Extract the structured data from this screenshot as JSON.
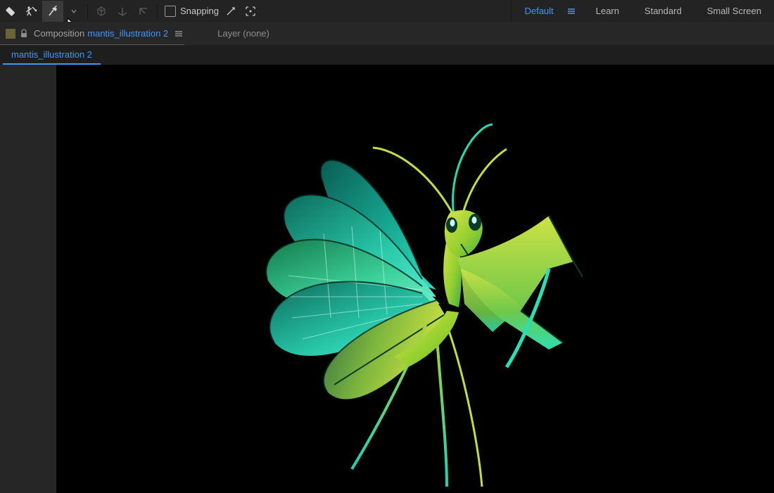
{
  "toolbar": {
    "snapping_label": "Snapping"
  },
  "workspaces": {
    "default": "Default",
    "learn": "Learn",
    "standard": "Standard",
    "small_screen": "Small Screen"
  },
  "panel_header": {
    "composition_label": "Composition",
    "composition_name": "mantis_illustration 2",
    "layer_label": "Layer (none)"
  },
  "tabs": {
    "active_tab": "mantis_illustration 2"
  },
  "colors": {
    "accent": "#3c97ff",
    "panel_bg": "#1e1e1e",
    "canvas_bg": "#000000"
  }
}
